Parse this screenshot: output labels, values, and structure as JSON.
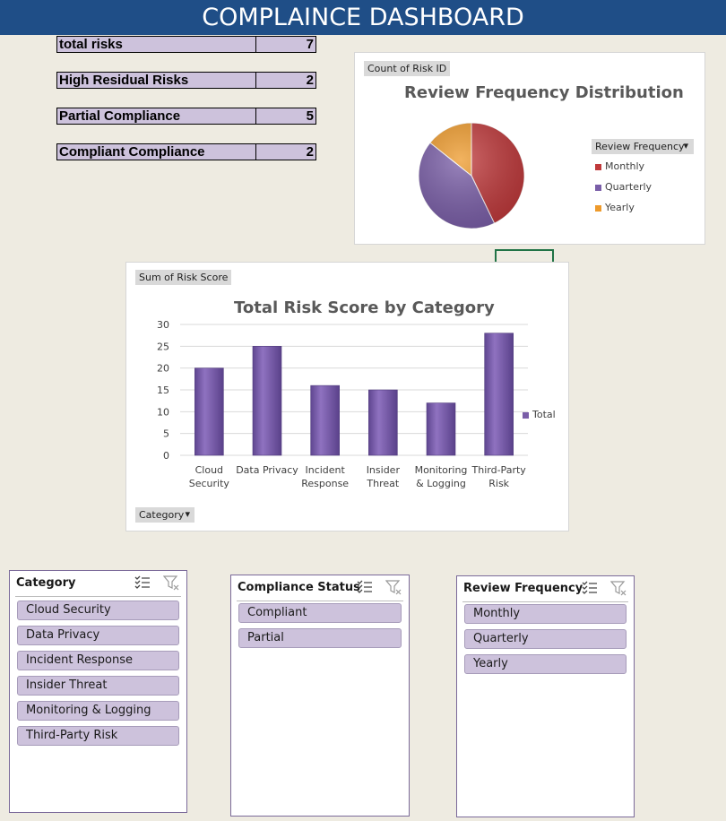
{
  "header": {
    "title": "COMPLAINCE DASHBOARD"
  },
  "kpis": [
    {
      "label": "total risks",
      "value": "7"
    },
    {
      "label": "High Residual Risks",
      "value": "2"
    },
    {
      "label": "Partial Compliance",
      "value": "5"
    },
    {
      "label": "Compliant Compliance",
      "value": "2"
    }
  ],
  "pie_chart": {
    "field_button": "Count of Risk ID",
    "legend_field": "Review Frequency",
    "chart_data": {
      "type": "pie",
      "title": "Review Frequency Distribution",
      "categories": [
        "Monthly",
        "Quarterly",
        "Yearly"
      ],
      "values": [
        3,
        3,
        1
      ],
      "colors": [
        "#c0393b",
        "#7a5ea8",
        "#ee9a2b"
      ]
    }
  },
  "bar_chart": {
    "field_button": "Sum of Risk Score",
    "axis_field": "Category",
    "chart_data": {
      "type": "bar",
      "title": "Total Risk Score by Category",
      "categories": [
        "Cloud Security",
        "Data Privacy",
        "Incident Response",
        "Insider Threat",
        "Monitoring & Logging",
        "Third-Party Risk"
      ],
      "category_lines": [
        [
          "Cloud",
          "Security"
        ],
        [
          "Data Privacy"
        ],
        [
          "Incident",
          "Response"
        ],
        [
          "Insider",
          "Threat"
        ],
        [
          "Monitoring",
          "& Logging"
        ],
        [
          "Third-Party",
          "Risk"
        ]
      ],
      "series": [
        {
          "name": "Total",
          "values": [
            20,
            25,
            16,
            15,
            12,
            28
          ]
        }
      ],
      "ylim": [
        0,
        30
      ],
      "yticks": [
        0,
        5,
        10,
        15,
        20,
        25,
        30
      ],
      "grid": true,
      "legend": "right",
      "color": "#7a5ea8"
    }
  },
  "slicers": {
    "category": {
      "title": "Category",
      "items": [
        "Cloud Security",
        "Data Privacy",
        "Incident Response",
        "Insider Threat",
        "Monitoring & Logging",
        "Third-Party Risk"
      ]
    },
    "compliance_status": {
      "title": "Compliance Status",
      "items": [
        "Compliant",
        "Partial"
      ]
    },
    "review_frequency": {
      "title": "Review Frequency",
      "items": [
        "Monthly",
        "Quarterly",
        "Yearly"
      ]
    }
  },
  "icons": {
    "multi_select": "multi-select-icon",
    "clear_filter": "clear-filter-icon",
    "dropdown": "dropdown-arrow-icon"
  }
}
